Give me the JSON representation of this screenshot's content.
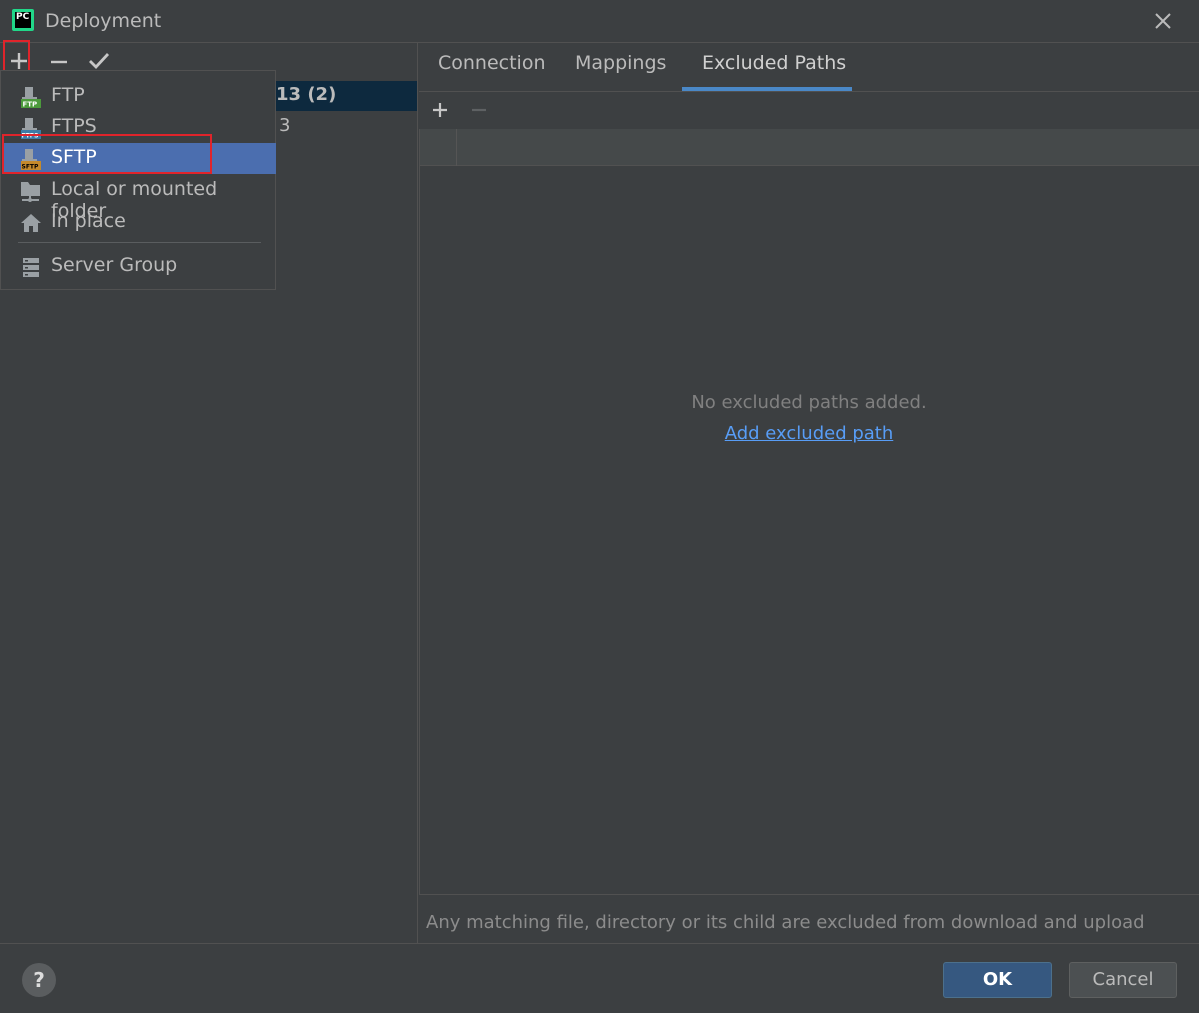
{
  "window": {
    "title": "Deployment",
    "logo_text": "PC"
  },
  "left_toolbar": {
    "icons": [
      "add-icon",
      "remove-icon",
      "checkmark-icon"
    ]
  },
  "server_list": {
    "row1_suffix": "13 (2)",
    "row2_suffix": "3"
  },
  "add_menu": {
    "items": [
      {
        "label": "FTP",
        "icon": "ftp-icon"
      },
      {
        "label": "FTPS",
        "icon": "ftps-icon"
      },
      {
        "label": "SFTP",
        "icon": "sftp-icon"
      },
      {
        "label": "Local or mounted folder",
        "icon": "folder-icon"
      },
      {
        "label": "In place",
        "icon": "home-icon"
      },
      {
        "label": "Server Group",
        "icon": "server-group-icon"
      }
    ],
    "selected": "SFTP"
  },
  "tabs": {
    "connection": "Connection",
    "mappings": "Mappings",
    "excluded_paths": "Excluded Paths",
    "active": "Excluded Paths"
  },
  "excluded_paths": {
    "empty_text": "No excluded paths added.",
    "add_link": "Add excluded path",
    "hint": "Any matching file, directory or its child are excluded from download and upload"
  },
  "footer": {
    "help": "?",
    "ok": "OK",
    "cancel": "Cancel"
  },
  "colors": {
    "background": "#3c3f41",
    "selection": "#4b6eaf",
    "accent": "#4a88c7",
    "highlight_box": "#e0242b",
    "link": "#589df6"
  }
}
